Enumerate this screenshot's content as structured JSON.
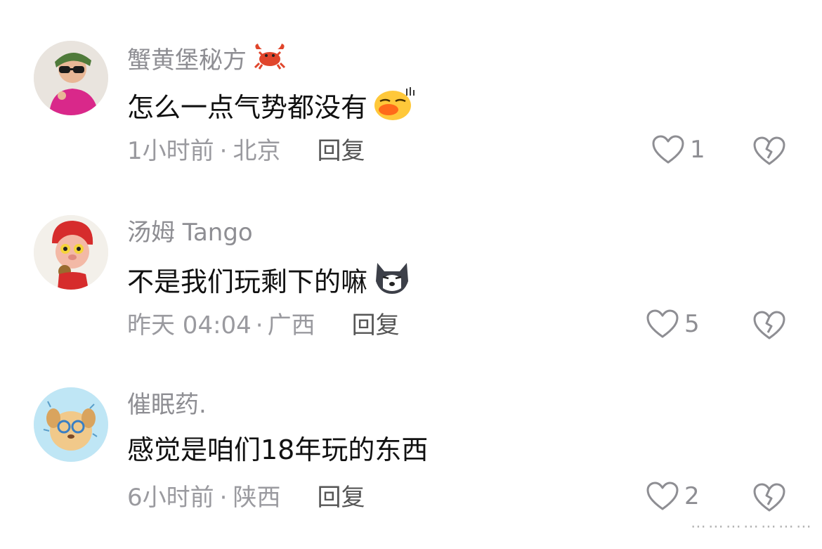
{
  "comments": [
    {
      "username": "蟹黄堡秘方",
      "username_emoji": "crab-emoji",
      "text": "怎么一点气势都没有",
      "text_emoji": "pouting-face-emoji",
      "time": "1小时前",
      "separator": "·",
      "location": "北京",
      "reply_label": "回复",
      "likes": "1"
    },
    {
      "username": "汤姆 Tango",
      "text": "不是我们玩剩下的嘛",
      "text_emoji": "husky-dog-emoji",
      "time": "昨天 04:04",
      "separator": "·",
      "location": "广西",
      "reply_label": "回复",
      "likes": "5"
    },
    {
      "username": "催眠药.",
      "text": "感觉是咱们18年玩的东西",
      "time": "6小时前",
      "separator": "·",
      "location": "陕西",
      "reply_label": "回复",
      "likes": "2"
    }
  ],
  "icons": {
    "like": "heart-outline-icon",
    "dislike": "broken-heart-outline-icon"
  },
  "colors": {
    "username": "#8e8e93",
    "text": "#111111",
    "meta": "#9a9a9f",
    "reply": "#555555"
  }
}
